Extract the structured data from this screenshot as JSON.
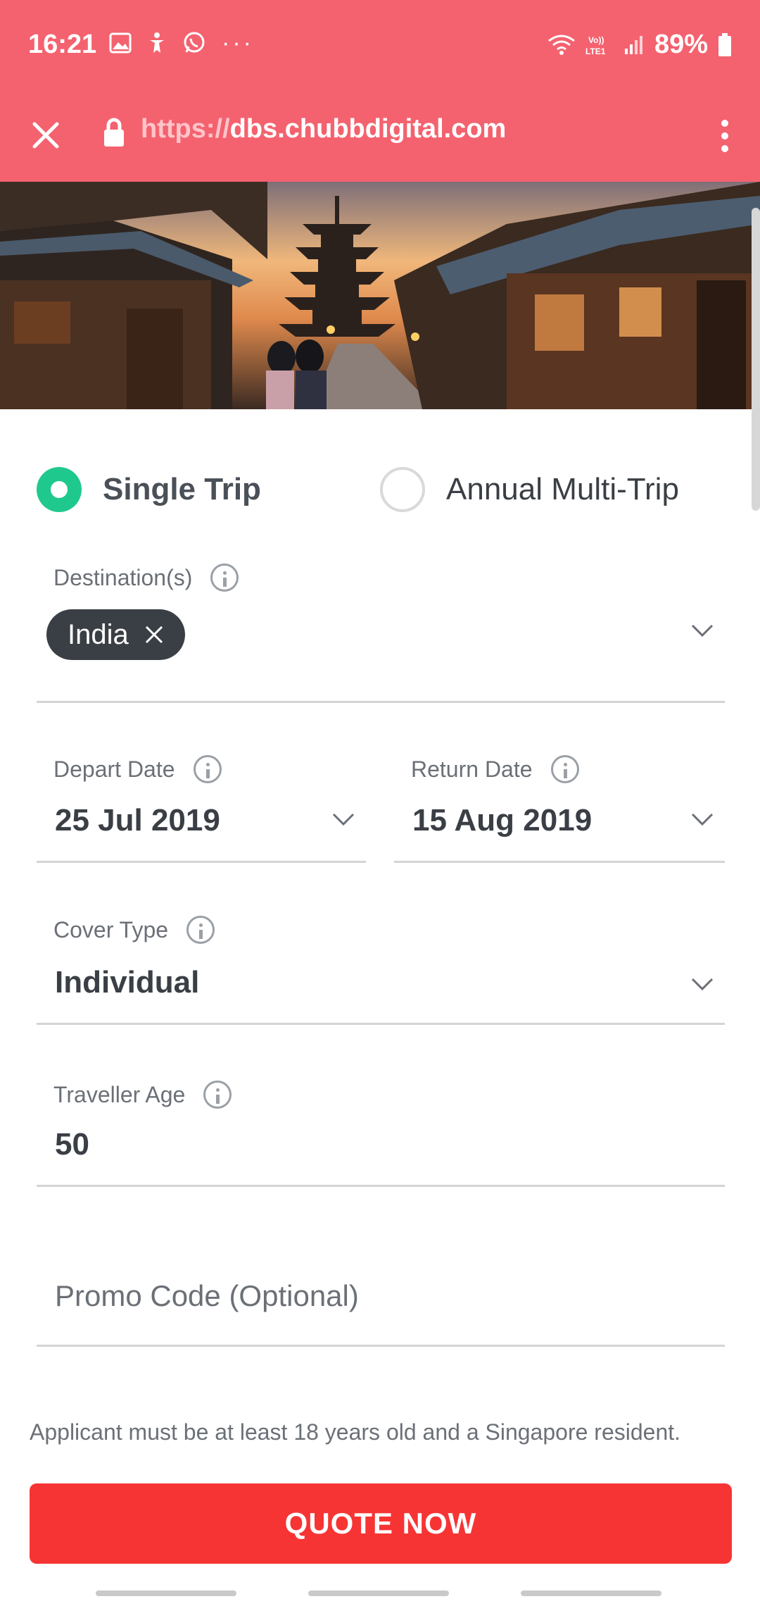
{
  "status_bar": {
    "time": "16:21",
    "battery": "89%",
    "more": "···"
  },
  "browser": {
    "url_scheme": "https://",
    "url_host": "dbs.chubbdigital.com"
  },
  "trip_type": {
    "options": [
      {
        "label": "Single Trip",
        "selected": true
      },
      {
        "label": "Annual Multi-Trip",
        "selected": false
      }
    ]
  },
  "destination": {
    "label": "Destination(s)",
    "chips": [
      "India"
    ]
  },
  "depart_date": {
    "label": "Depart Date",
    "value": "25 Jul 2019"
  },
  "return_date": {
    "label": "Return Date",
    "value": "15 Aug 2019"
  },
  "cover_type": {
    "label": "Cover Type",
    "value": "Individual"
  },
  "traveller_age": {
    "label": "Traveller Age",
    "value": "50"
  },
  "promo_code": {
    "placeholder": "Promo Code (Optional)"
  },
  "notice": "Applicant must be at least 18 years old and a Singapore resident.",
  "quote_button": "QUOTE NOW",
  "colors": {
    "header": "#f4626f",
    "radio_selected": "#1fc98e",
    "chip": "#3a3f45",
    "cta": "#f73434"
  }
}
